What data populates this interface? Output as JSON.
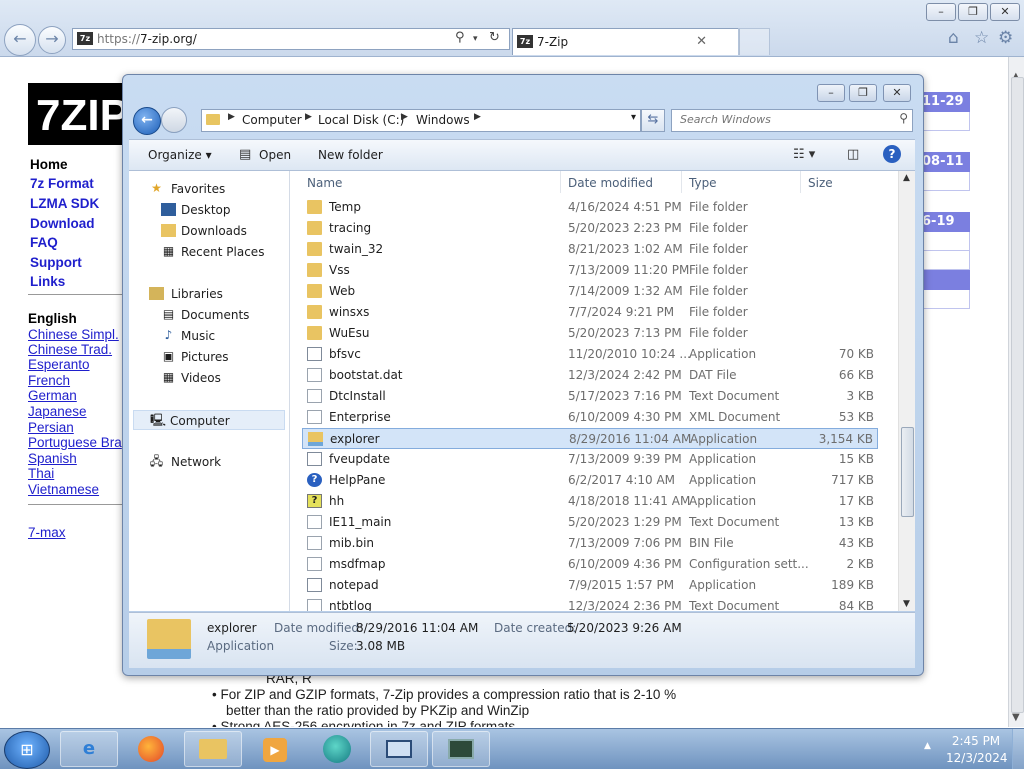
{
  "browser": {
    "url_scheme": "https://",
    "url_rest": "7-zip.org/",
    "tab_title": "7-Zip",
    "favicon_text": "7z",
    "window_controls": [
      "–",
      "❐",
      "✕"
    ],
    "toolbar_icons": [
      "home-icon",
      "star-icon",
      "gear-icon"
    ]
  },
  "site": {
    "logo": "7ZIP",
    "nav": [
      "Home",
      "7z Format",
      "LZMA SDK",
      "Download",
      "FAQ",
      "Support",
      "Links"
    ],
    "lang_title": "English",
    "languages": [
      "Chinese Simpl.",
      "Chinese Trad.",
      "Esperanto",
      "French",
      "German",
      "Japanese",
      "Persian",
      "Portuguese Bra",
      "Spanish",
      "Thai",
      "Vietnamese"
    ],
    "extra_link": "7-max",
    "news_dates": [
      "11-29",
      "08-11",
      "6-19"
    ],
    "body_rar": "RAR, R",
    "body_bullet1a": "For ZIP and GZIP formats, 7-Zip provides a compression ratio that is 2-10 %",
    "body_bullet1b": "better than the ratio provided by PKZip and WinZip",
    "body_bullet2": "Strong AES-256 encryption in 7z and ZIP formats"
  },
  "explorer": {
    "breadcrumb": [
      "Computer",
      "Local Disk (C:)",
      "Windows"
    ],
    "search_placeholder": "Search Windows",
    "toolbar": {
      "organize": "Organize ▾",
      "open": "Open",
      "new_folder": "New folder"
    },
    "nav": {
      "favorites": "Favorites",
      "desktop": "Desktop",
      "downloads": "Downloads",
      "recent": "Recent Places",
      "libraries": "Libraries",
      "documents": "Documents",
      "music": "Music",
      "pictures": "Pictures",
      "videos": "Videos",
      "computer": "Computer",
      "network": "Network"
    },
    "columns": {
      "name": "Name",
      "date": "Date modified",
      "type": "Type",
      "size": "Size"
    },
    "files": [
      {
        "name": "Temp",
        "date": "4/16/2024 4:51 PM",
        "type": "File folder",
        "size": "",
        "icon": "folder"
      },
      {
        "name": "tracing",
        "date": "5/20/2023 2:23 PM",
        "type": "File folder",
        "size": "",
        "icon": "folder"
      },
      {
        "name": "twain_32",
        "date": "8/21/2023 1:02 AM",
        "type": "File folder",
        "size": "",
        "icon": "folder"
      },
      {
        "name": "Vss",
        "date": "7/13/2009 11:20 PM",
        "type": "File folder",
        "size": "",
        "icon": "folder"
      },
      {
        "name": "Web",
        "date": "7/14/2009 1:32 AM",
        "type": "File folder",
        "size": "",
        "icon": "folder"
      },
      {
        "name": "winsxs",
        "date": "7/7/2024 9:21 PM",
        "type": "File folder",
        "size": "",
        "icon": "folder"
      },
      {
        "name": "WuEsu",
        "date": "5/20/2023 7:13 PM",
        "type": "File folder",
        "size": "",
        "icon": "folder"
      },
      {
        "name": "bfsvc",
        "date": "11/20/2010 10:24 ...",
        "type": "Application",
        "size": "70 KB",
        "icon": "app"
      },
      {
        "name": "bootstat.dat",
        "date": "12/3/2024 2:42 PM",
        "type": "DAT File",
        "size": "66 KB",
        "icon": "doc"
      },
      {
        "name": "DtcInstall",
        "date": "5/17/2023 7:16 PM",
        "type": "Text Document",
        "size": "3 KB",
        "icon": "doc"
      },
      {
        "name": "Enterprise",
        "date": "6/10/2009 4:30 PM",
        "type": "XML Document",
        "size": "53 KB",
        "icon": "doc"
      },
      {
        "name": "explorer",
        "date": "8/29/2016 11:04 AM",
        "type": "Application",
        "size": "3,154 KB",
        "icon": "explorer"
      },
      {
        "name": "fveupdate",
        "date": "7/13/2009 9:39 PM",
        "type": "Application",
        "size": "15 KB",
        "icon": "app"
      },
      {
        "name": "HelpPane",
        "date": "6/2/2017 4:10 AM",
        "type": "Application",
        "size": "717 KB",
        "icon": "help"
      },
      {
        "name": "hh",
        "date": "4/18/2018 11:41 AM",
        "type": "Application",
        "size": "17 KB",
        "icon": "hh"
      },
      {
        "name": "IE11_main",
        "date": "5/20/2023 1:29 PM",
        "type": "Text Document",
        "size": "13 KB",
        "icon": "doc"
      },
      {
        "name": "mib.bin",
        "date": "7/13/2009 7:06 PM",
        "type": "BIN File",
        "size": "43 KB",
        "icon": "doc"
      },
      {
        "name": "msdfmap",
        "date": "6/10/2009 4:36 PM",
        "type": "Configuration sett...",
        "size": "2 KB",
        "icon": "doc"
      },
      {
        "name": "notepad",
        "date": "7/9/2015 1:57 PM",
        "type": "Application",
        "size": "189 KB",
        "icon": "app"
      },
      {
        "name": "ntbtlog",
        "date": "12/3/2024 2:36 PM",
        "type": "Text Document",
        "size": "84 KB",
        "icon": "doc"
      }
    ],
    "selected_index": 11,
    "details": {
      "name": "explorer",
      "type": "Application",
      "date_modified_label": "Date modified:",
      "date_modified": "8/29/2016 11:04 AM",
      "date_created_label": "Date created:",
      "date_created": "5/20/2023 9:26 AM",
      "size_label": "Size:",
      "size": "3.08 MB"
    }
  },
  "taskbar": {
    "time": "2:45 PM",
    "date": "12/3/2024",
    "apps": [
      "ie-icon",
      "firefox-icon",
      "explorer-folder-icon",
      "media-player-icon",
      "browser-globe-icon",
      "display-icon",
      "terminal-icon"
    ]
  },
  "colors": {
    "link": "#1f1fcc",
    "news_bg": "#7b7fe0",
    "selection": "#d3e4f8"
  }
}
